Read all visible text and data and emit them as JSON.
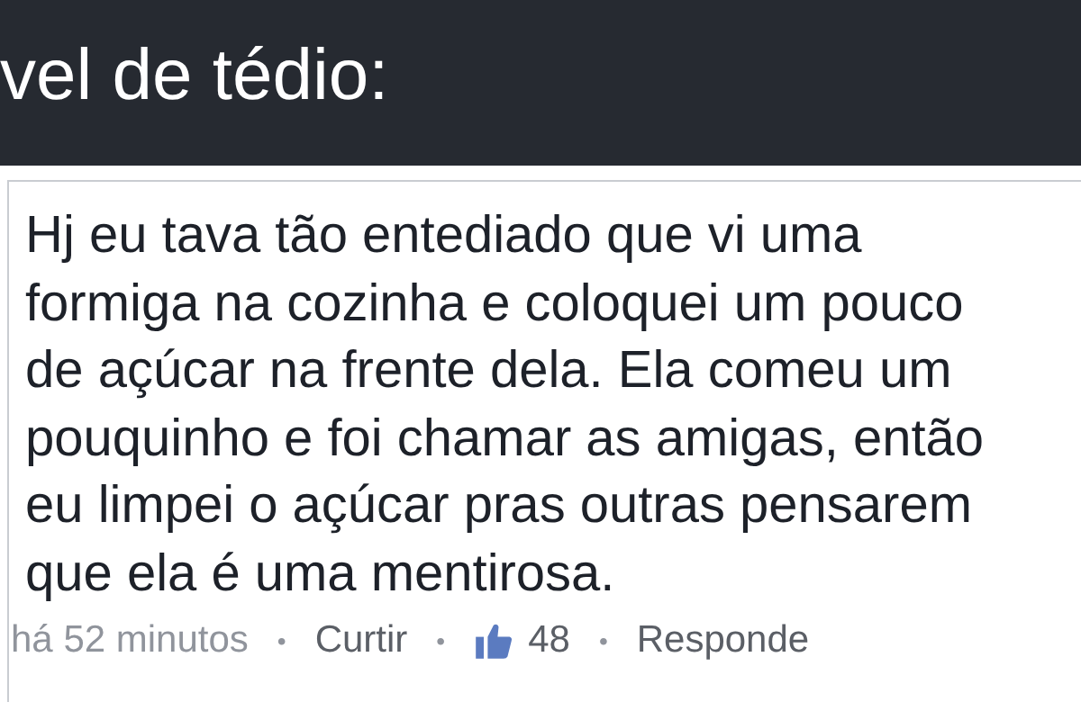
{
  "header": {
    "title": "vel de tédio:"
  },
  "comment": {
    "text": "Hj eu tava tão entediado que vi uma\nformiga na cozinha e coloquei um pouco\nde açúcar na frente dela. Ela comeu um\npouquinho e foi chamar as amigas, então\neu limpei o açúcar pras outras pensarem\nque ela é uma mentirosa.",
    "footer": [
      {
        "kind": "time",
        "text": "há 52 minutos"
      },
      {
        "kind": "dot",
        "text": "•"
      },
      {
        "kind": "link",
        "text": "Curtir"
      },
      {
        "kind": "dot",
        "text": "•"
      },
      {
        "kind": "likes",
        "text": "48"
      },
      {
        "kind": "dot",
        "text": "•"
      },
      {
        "kind": "link",
        "text": "Responde"
      }
    ]
  }
}
